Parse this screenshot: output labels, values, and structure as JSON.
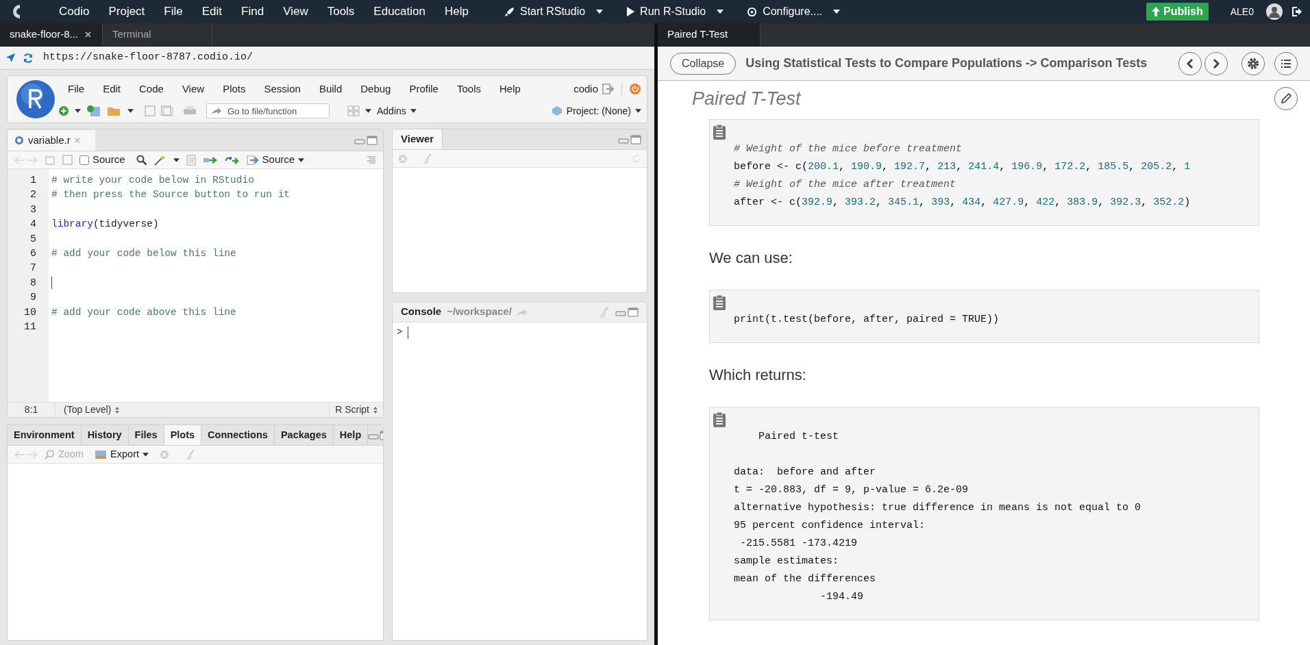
{
  "top_bar": {
    "menu": [
      "Codio",
      "Project",
      "File",
      "Edit",
      "Find",
      "View",
      "Tools",
      "Education",
      "Help"
    ],
    "actions": [
      {
        "kind": "rocket",
        "label": "Start RStudio"
      },
      {
        "kind": "play",
        "label": "Run R-Studio"
      },
      {
        "kind": "configure",
        "label": "Configure...."
      }
    ],
    "publish": "Publish",
    "user": "ALE0"
  },
  "left_tabs": [
    {
      "label": "snake-floor-8...",
      "selected": true,
      "closable": true
    },
    {
      "label": "Terminal",
      "selected": false,
      "closable": false
    }
  ],
  "url": "https://snake-floor-8787.codio.io/",
  "rstudio": {
    "menu": [
      "File",
      "Edit",
      "Code",
      "View",
      "Plots",
      "Session",
      "Build",
      "Debug",
      "Profile",
      "Tools",
      "Help"
    ],
    "user": "codio",
    "goto_placeholder": "Go to file/function",
    "addins": "Addins",
    "project": "Project: (None)",
    "source_pane": {
      "tabs": [
        {
          "label": "variable.r",
          "selected": true
        }
      ],
      "source_on_save": {
        "label": "Source",
        "checked": false
      },
      "source_button": "Source",
      "lines": [
        {
          "number": "1",
          "kind": "comment",
          "text": "# write your code below in RStudio",
          "cursor": false
        },
        {
          "number": "2",
          "kind": "comment",
          "text": "# then press the Source button to run it",
          "cursor": false
        },
        {
          "number": "3",
          "kind": "blank",
          "cursor": false
        },
        {
          "number": "4",
          "kind": "call",
          "fn": "library",
          "text": "(tidyverse)",
          "cursor": false
        },
        {
          "number": "5",
          "kind": "blank",
          "cursor": false
        },
        {
          "number": "6",
          "kind": "comment",
          "text": "# add your code below this line",
          "cursor": false
        },
        {
          "number": "7",
          "kind": "blank",
          "cursor": false
        },
        {
          "number": "8",
          "kind": "blank",
          "cursor": true
        },
        {
          "number": "9",
          "kind": "blank",
          "cursor": false
        },
        {
          "number": "10",
          "kind": "comment",
          "text": "# add your code above this line",
          "cursor": false
        },
        {
          "number": "11",
          "kind": "blank",
          "cursor": false
        }
      ],
      "status": {
        "position": "8:1",
        "scope": "(Top Level)",
        "file_type": "R Script"
      }
    },
    "viewer": {
      "tabs": [
        {
          "label": "Viewer",
          "selected": true
        }
      ]
    },
    "console": {
      "title": "Console",
      "path": "~/workspace/",
      "prompt": ">"
    },
    "files_pane": {
      "tabs": [
        {
          "label": "Environment",
          "selected": false
        },
        {
          "label": "History",
          "selected": false
        },
        {
          "label": "Files",
          "selected": false
        },
        {
          "label": "Plots",
          "selected": true
        },
        {
          "label": "Connections",
          "selected": false
        },
        {
          "label": "Packages",
          "selected": false
        },
        {
          "label": "Help",
          "selected": false
        }
      ],
      "zoom": "Zoom",
      "export": "Export"
    }
  },
  "right_tabs": [
    {
      "label": "Paired T-Test",
      "selected": true
    }
  ],
  "guide": {
    "collapse": "Collapse",
    "breadcrumb": "Using Statistical Tests to Compare Populations -> Comparison Tests",
    "title": "Paired T-Test",
    "blocks": [
      {
        "kind": "code",
        "lines": [
          {
            "kind": "comment",
            "text": "# Weight of the mice before treatment"
          },
          {
            "kind": "code",
            "text": "before <- c(200.1, 190.9, 192.7, 213, 241.4, 196.9, 172.2, 185.5, 205.2, 1"
          },
          {
            "kind": "comment",
            "text": "# Weight of the mice after treatment"
          },
          {
            "kind": "code",
            "text": "after <- c(392.9, 393.2, 345.1, 393, 434, 427.9, 422, 383.9, 392.3, 352.2)"
          }
        ]
      },
      {
        "kind": "paragraph",
        "text": "We can use:"
      },
      {
        "kind": "code",
        "lines": [
          {
            "kind": "plain",
            "text": "print(t.test(before, after, paired = TRUE))"
          }
        ]
      },
      {
        "kind": "paragraph",
        "text": "Which returns:"
      },
      {
        "kind": "code",
        "lines": [
          {
            "kind": "plain",
            "text": "    Paired t-test"
          },
          {
            "kind": "blank"
          },
          {
            "kind": "plain",
            "text": "data:  before and after"
          },
          {
            "kind": "plain",
            "text": "t = -20.883, df = 9, p-value = 6.2e-09"
          },
          {
            "kind": "plain",
            "text": "alternative hypothesis: true difference in means is not equal to 0"
          },
          {
            "kind": "plain",
            "text": "95 percent confidence interval:"
          },
          {
            "kind": "plain",
            "text": " -215.5581 -173.4219"
          },
          {
            "kind": "plain",
            "text": "sample estimates:"
          },
          {
            "kind": "plain",
            "text": "mean of the differences"
          },
          {
            "kind": "plain",
            "text": "              -194.49"
          }
        ]
      }
    ]
  }
}
